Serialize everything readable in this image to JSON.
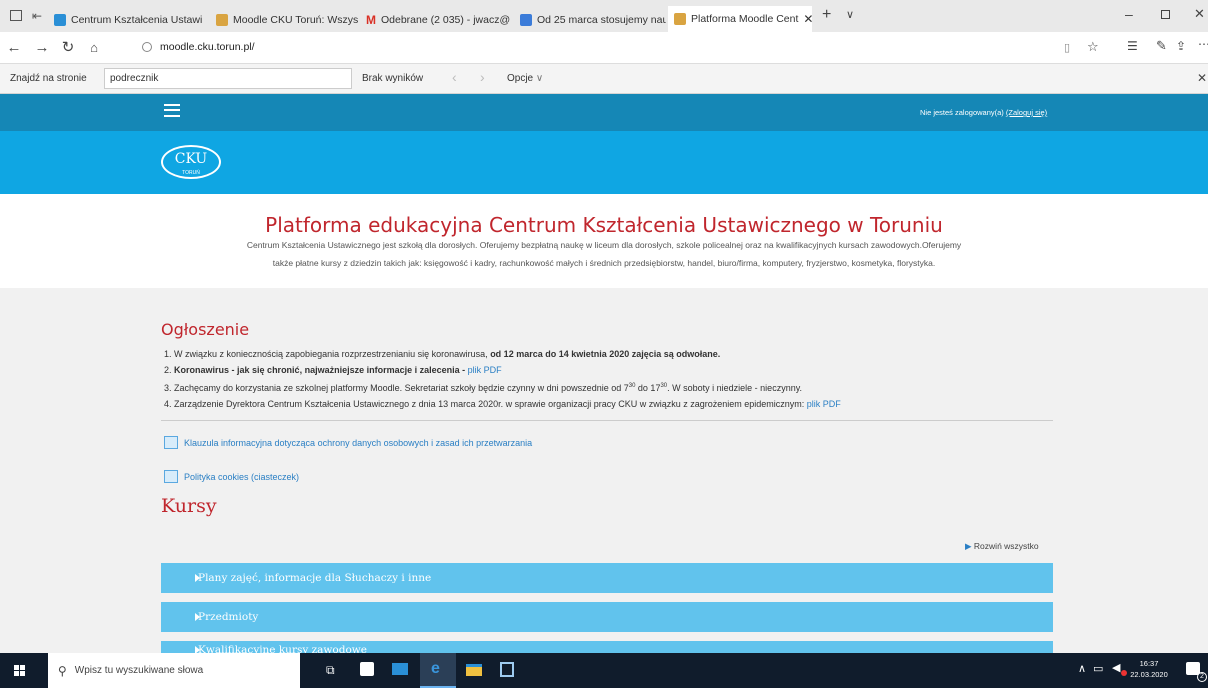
{
  "browser": {
    "tabs": [
      {
        "label": "Centrum Kształcenia Ustawi",
        "color": "#2a8fd6"
      },
      {
        "label": "Moodle CKU Toruń: Wszystł",
        "color": "#d9a441"
      },
      {
        "label": "Odebrane (2 035) - jwacz@",
        "color": "#d93025"
      },
      {
        "label": "Od 25 marca stosujemy nau",
        "color": "#3b7cd9"
      },
      {
        "label": "Platforma Moodle Cent",
        "color": "#d9a441",
        "active": true
      }
    ],
    "url": "moodle.cku.torun.pl/",
    "find": {
      "label": "Znajdź na stronie",
      "query": "podrecznik",
      "result": "Brak wyników",
      "options": "Opcje"
    }
  },
  "header": {
    "login_text": "Nie jesteś zalogowany(a)",
    "login_link": "(Zaloguj się)",
    "logo_text": "CKU",
    "logo_sub": "TORUŃ"
  },
  "intro": {
    "title": "Platforma edukacyjna Centrum Kształcenia Ustawicznego w Toruniu",
    "line1": "Centrum Kształcenia Ustawicznego jest szkołą dla dorosłych. Oferujemy bezpłatną naukę w liceum dla dorosłych, szkole policealnej oraz na kwalifikacyjnych kursach zawodowych.Oferujemy",
    "line2": "także płatne kursy z dziedzin takich jak: księgowość i kadry, rachunkowość małych i średnich przedsiębiorstw, handel, biuro/firma, komputery, fryzjerstwo, kosmetyka, florystyka."
  },
  "announcement": {
    "heading": "Ogłoszenie",
    "items": {
      "i1_a": "1. W związku z koniecznością zapobiegania rozprzestrzenianiu się koronawirusa,",
      "i1_b": "od 12 marca do 14 kwietnia 2020 zajęcia są odwołane.",
      "i2_a": "2.",
      "i2_b": "Koronawirus - jak się chronić, najważniejsze informacje i zalecenia -",
      "i2_link": "plik PDF",
      "i3_a": "3. Zachęcamy do korzystania ze szkolnej platformy Moodle. Sekretariat szkoły będzie czynny w dni powszednie od 7",
      "i3_sup1": "30",
      "i3_b": " do 17",
      "i3_sup2": "30",
      "i3_c": ". W soboty i niedziele - nieczynny.",
      "i4_a": "4. Zarządzenie Dyrektora Centrum Kształcenia Ustawicznego z dnia 13 marca 2020r. w sprawie organizacji pracy CKU w związku z zagrożeniem epidemicznym:",
      "i4_link": "plik PDF"
    }
  },
  "links": {
    "clause": "Klauzula informacyjna dotycząca ochrony danych osobowych i zasad ich przetwarzania",
    "cookies": "Polityka cookies (ciasteczek)"
  },
  "courses": {
    "heading": "Kursy",
    "expand_all": "Rozwiń wszystko",
    "items": [
      "Plany zajęć, informacje dla Słuchaczy i inne",
      "Przedmioty",
      "Kwalifikacyjne kursy zawodowe"
    ]
  },
  "taskbar": {
    "search_placeholder": "Wpisz tu wyszukiwane słowa",
    "time": "16:37",
    "date": "22.03.2020",
    "notif": "2"
  }
}
